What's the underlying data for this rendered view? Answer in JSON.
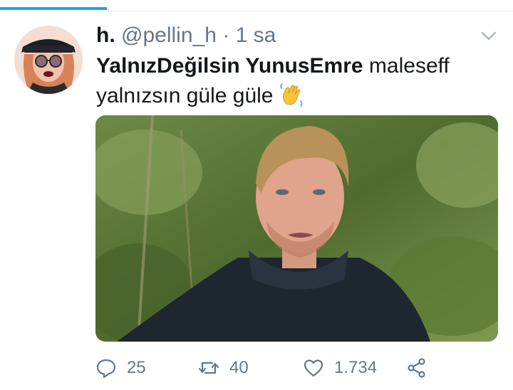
{
  "tweet": {
    "author_name": "h.",
    "handle": "@pellin_h",
    "separator": "·",
    "time": "1 sa",
    "hashtag": "YalnızDeğilsin YunusEmre",
    "text_line1": " maleseff",
    "text_line2": "yalnızsın güle güle ",
    "emoji": "waving-hand-icon"
  },
  "actions": {
    "replies": "25",
    "retweets": "40",
    "likes": "1.734"
  },
  "colors": {
    "accent": "#1da1f2",
    "secondary_text": "#657786",
    "primary_text": "#14171a"
  }
}
